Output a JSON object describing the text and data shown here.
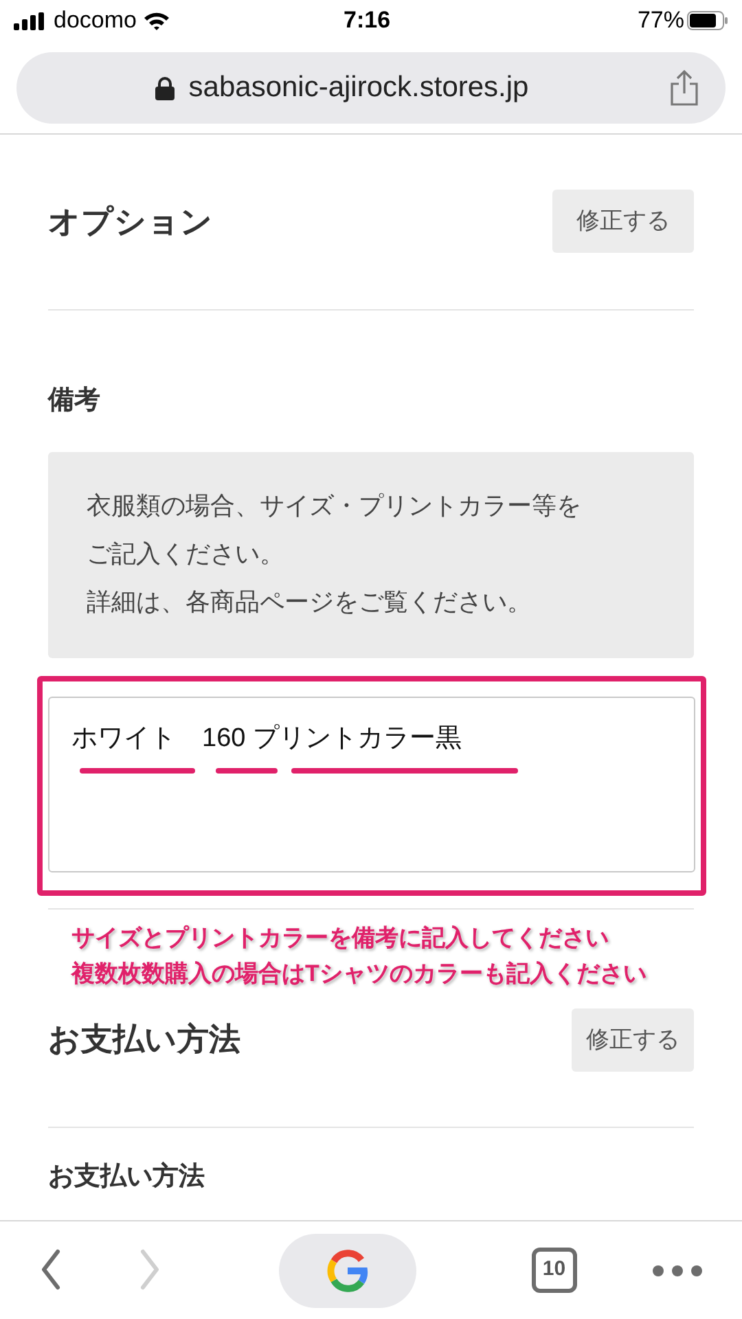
{
  "status_bar": {
    "carrier": "docomo",
    "time": "7:16",
    "battery": "77%"
  },
  "address_bar": {
    "url": "sabasonic-ajirock.stores.jp"
  },
  "option_section": {
    "title": "オプション",
    "button": "修正する"
  },
  "remarks": {
    "label": "備考",
    "note_lines": [
      "衣服類の場合、サイズ・プリントカラー等を",
      "ご記入ください。",
      "詳細は、各商品ページをご覧ください。"
    ],
    "value": "ホワイト　160 プリントカラー黒"
  },
  "annotation": {
    "lines": [
      "サイズとプリントカラーを備考に記入してください",
      "複数枚数購入の場合はTシャツのカラーも記入ください"
    ]
  },
  "payment_section": {
    "title": "お支払い方法",
    "button": "修正する",
    "subtitle": "お支払い方法"
  },
  "toolbar": {
    "back_disabled": false,
    "forward_disabled": true,
    "tab_count": "10"
  }
}
